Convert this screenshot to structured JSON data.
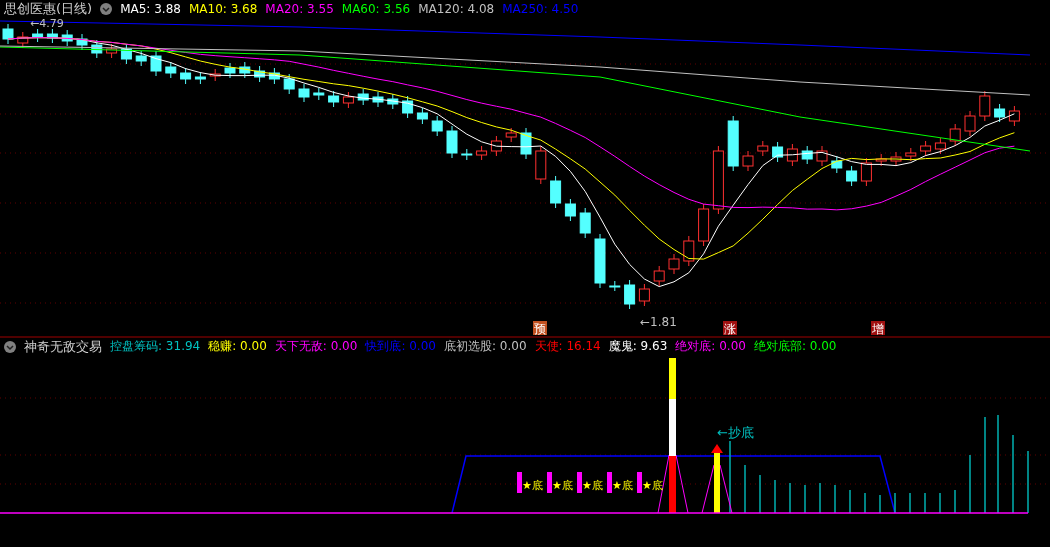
{
  "header": {
    "title": "思创医惠(日线)",
    "ma_legend": [
      {
        "label": "MA5: 3.88",
        "color": "#ffffff"
      },
      {
        "label": "MA10: 3.68",
        "color": "#ffff00"
      },
      {
        "label": "MA20: 3.55",
        "color": "#ff00ff"
      },
      {
        "label": "MA60: 3.56",
        "color": "#00ff00"
      },
      {
        "label": "MA120: 4.08",
        "color": "#c0c0c0"
      },
      {
        "label": "MA250: 4.50",
        "color": "#0000ff"
      }
    ]
  },
  "price_chart": {
    "high_label": "←4.79",
    "low_label": "←1.81",
    "signals": [
      {
        "text": "预",
        "color": "#c05020"
      },
      {
        "text": "涨",
        "color": "#a01010"
      },
      {
        "text": "增",
        "color": "#a01010"
      }
    ]
  },
  "indicator": {
    "name": "神奇无敌交易",
    "values": [
      {
        "label": "控盘筹码: 31.94",
        "color": "#00c0c0"
      },
      {
        "label": "稳赚: 0.00",
        "color": "#ffff00"
      },
      {
        "label": "天下无敌: 0.00",
        "color": "#ff00ff"
      },
      {
        "label": "快到底: 0.00",
        "color": "#0000ff"
      },
      {
        "label": "底初选股: 0.00",
        "color": "#c0c0c0"
      },
      {
        "label": "天使: 16.14",
        "color": "#ff0000"
      },
      {
        "label": "魔鬼: 9.63",
        "color": "#ffffff"
      },
      {
        "label": "绝对底: 0.00",
        "color": "#ff00ff"
      },
      {
        "label": "绝对底部: 0.00",
        "color": "#00ff00"
      }
    ],
    "star_marks": [
      "★底",
      "★底",
      "★底",
      "★底",
      "★底"
    ],
    "buy_label": "←抄底"
  }
}
